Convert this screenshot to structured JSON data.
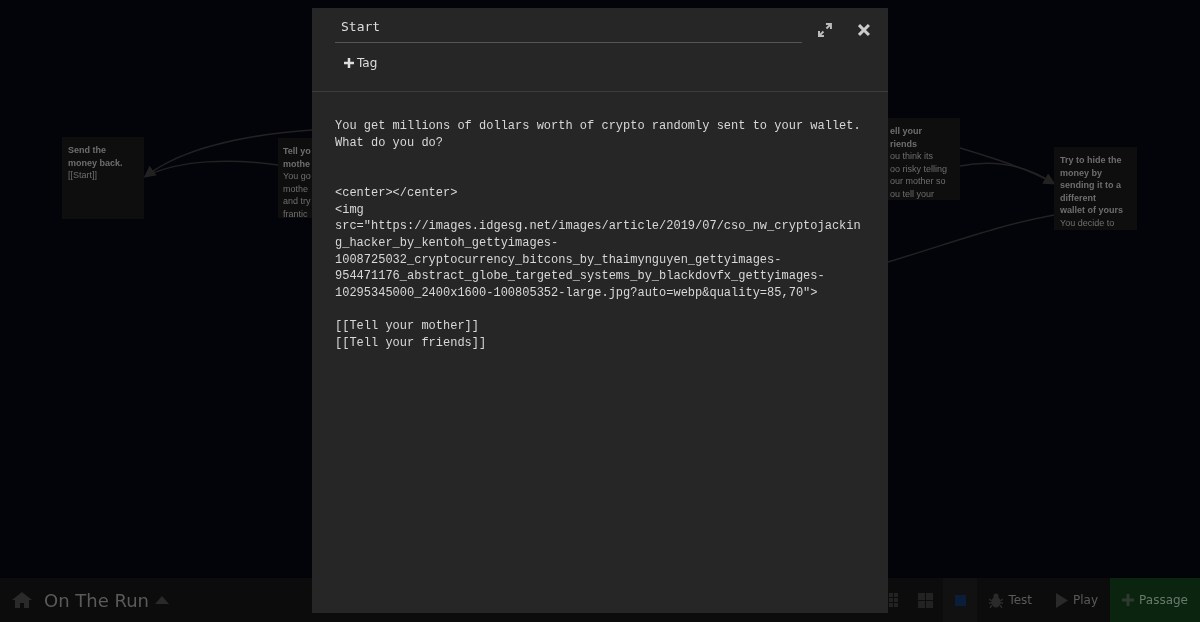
{
  "story_map": {
    "passages": [
      {
        "kind": "full",
        "title_lines": [
          "Send the",
          "money back."
        ],
        "body_lines": [
          "[[Start]]"
        ]
      },
      {
        "kind": "clipped_right",
        "title_lines": [
          "Tell yo",
          "mothe"
        ],
        "body_lines": [
          "You go",
          "mothe",
          "and try",
          "frantic"
        ]
      },
      {
        "kind": "clipped_left",
        "title_lines": [
          "ell your",
          "riends"
        ],
        "body_lines": [
          "ou think its",
          "oo risky telling",
          "our mother so",
          "ou tell your"
        ]
      },
      {
        "kind": "full",
        "title_lines": [
          "Try to hide the",
          "money by",
          "sending it to a",
          "different",
          "wallet of yours"
        ],
        "body_lines": [
          "You decide to"
        ]
      }
    ]
  },
  "bottom_bar": {
    "story_title": "On The Run",
    "buttons": [
      {
        "kind": "test",
        "label": "Test"
      },
      {
        "kind": "play",
        "label": "Play"
      },
      {
        "kind": "passage",
        "label": "Passage"
      }
    ]
  },
  "dialog": {
    "passage_name": "Start",
    "tag_button": "Tag",
    "text": "You get millions of dollars worth of crypto randomly sent to your wallet. What do you do?\n\n\n<center></center>\n<img src=\"https://images.idgesg.net/images/article/2019/07/cso_nw_cryptojacking_hacker_by_kentoh_gettyimages-1008725032_cryptocurrency_bitcons_by_thaimynguyen_gettyimages-954471176_abstract_globe_targeted_systems_by_blackdovfx_gettyimages-10295345000_2400x1600-100805352-large.jpg?auto=webp&quality=85,70\">\n\n[[Tell your mother]]\n[[Tell your friends]]"
  }
}
